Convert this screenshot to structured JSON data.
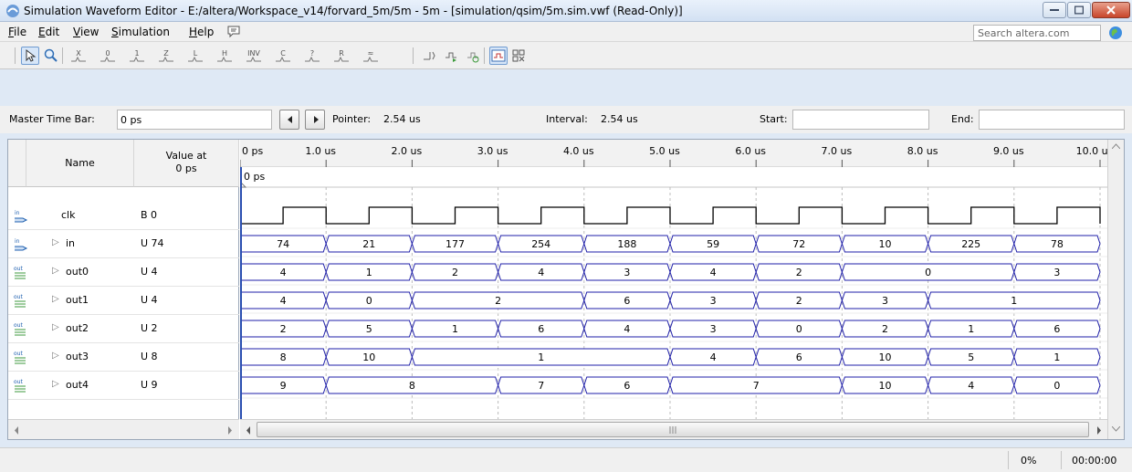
{
  "window": {
    "title": "Simulation Waveform Editor - E:/altera/Workspace_v14/forvard_5m/5m - 5m - [simulation/qsim/5m.sim.vwf (Read-Only)]"
  },
  "menu": {
    "items": [
      {
        "key": "F",
        "rest": "ile"
      },
      {
        "key": "E",
        "rest": "dit"
      },
      {
        "key": "V",
        "rest": "iew"
      },
      {
        "key": "S",
        "rest": "imulation"
      },
      {
        "key": "H",
        "rest": "elp"
      }
    ]
  },
  "search": {
    "placeholder": "Search altera.com"
  },
  "toolbar": {
    "buttons": [
      {
        "icon": "selection-tool-icon"
      },
      {
        "icon": "zoom-tool-icon"
      },
      {
        "icon": "forcing-unknown-icon"
      },
      {
        "icon": "forcing-low-icon"
      },
      {
        "icon": "forcing-high-icon"
      },
      {
        "icon": "high-impedance-icon"
      },
      {
        "icon": "weak-low-icon"
      },
      {
        "icon": "weak-high-icon"
      },
      {
        "icon": "invert-icon"
      },
      {
        "icon": "count-value-icon"
      },
      {
        "icon": "overwrite-clock-icon"
      },
      {
        "icon": "arbitrary-value-icon"
      },
      {
        "icon": "random-value-icon"
      },
      {
        "icon": "snap-to-grid-icon"
      },
      {
        "icon": "grid-settings-icon"
      },
      {
        "icon": "end-time-icon"
      },
      {
        "icon": "run-functional-simulation-icon"
      },
      {
        "icon": "run-timing-simulation-icon"
      }
    ]
  },
  "timebar": {
    "master_label": "Master Time Bar:",
    "master_value": "0 ps",
    "pointer_label": "Pointer:",
    "pointer_value": "2.54 us",
    "interval_label": "Interval:",
    "interval_value": "2.54 us",
    "start_label": "Start:",
    "start_value": "",
    "end_label": "End:",
    "end_value": ""
  },
  "table": {
    "name_header": "Name",
    "value_header_line1": "Value at",
    "value_header_line2": "0 ps",
    "master_marker_label": "0 ps",
    "time_ticks": [
      "0 ps",
      "1.0 us",
      "2.0 us",
      "3.0 us",
      "4.0 us",
      "5.0 us",
      "6.0 us",
      "7.0 us",
      "8.0 us",
      "9.0 us",
      "10.0 us"
    ],
    "signals": [
      {
        "name": "clk",
        "value": "B 0",
        "direction": "in",
        "expandable": false,
        "kind": "clock"
      },
      {
        "name": "in",
        "value": "U 74",
        "direction": "in",
        "expandable": true,
        "kind": "bus",
        "segments": [
          [
            "74",
            0,
            1
          ],
          [
            "21",
            1,
            2
          ],
          [
            "177",
            2,
            3
          ],
          [
            "254",
            3,
            4
          ],
          [
            "188",
            4,
            5
          ],
          [
            "59",
            5,
            6
          ],
          [
            "72",
            6,
            7
          ],
          [
            "10",
            7,
            8
          ],
          [
            "225",
            8,
            9
          ],
          [
            "78",
            9,
            10
          ]
        ]
      },
      {
        "name": "out0",
        "value": "U 4",
        "direction": "out",
        "expandable": true,
        "kind": "bus",
        "segments": [
          [
            "4",
            0,
            1
          ],
          [
            "1",
            1,
            2
          ],
          [
            "2",
            2,
            3
          ],
          [
            "4",
            3,
            4
          ],
          [
            "3",
            4,
            5
          ],
          [
            "4",
            5,
            6
          ],
          [
            "2",
            6,
            7
          ],
          [
            "0",
            7,
            9
          ],
          [
            "3",
            9,
            10
          ]
        ]
      },
      {
        "name": "out1",
        "value": "U 4",
        "direction": "out",
        "expandable": true,
        "kind": "bus",
        "segments": [
          [
            "4",
            0,
            1
          ],
          [
            "0",
            1,
            2
          ],
          [
            "2",
            2,
            4
          ],
          [
            "6",
            4,
            5
          ],
          [
            "3",
            5,
            6
          ],
          [
            "2",
            6,
            7
          ],
          [
            "3",
            7,
            8
          ],
          [
            "1",
            8,
            10
          ]
        ]
      },
      {
        "name": "out2",
        "value": "U 2",
        "direction": "out",
        "expandable": true,
        "kind": "bus",
        "segments": [
          [
            "2",
            0,
            1
          ],
          [
            "5",
            1,
            2
          ],
          [
            "1",
            2,
            3
          ],
          [
            "6",
            3,
            4
          ],
          [
            "4",
            4,
            5
          ],
          [
            "3",
            5,
            6
          ],
          [
            "0",
            6,
            7
          ],
          [
            "2",
            7,
            8
          ],
          [
            "1",
            8,
            9
          ],
          [
            "6",
            9,
            10
          ]
        ]
      },
      {
        "name": "out3",
        "value": "U 8",
        "direction": "out",
        "expandable": true,
        "kind": "bus",
        "segments": [
          [
            "8",
            0,
            1
          ],
          [
            "10",
            1,
            2
          ],
          [
            "1",
            2,
            5
          ],
          [
            "4",
            5,
            6
          ],
          [
            "6",
            6,
            7
          ],
          [
            "10",
            7,
            8
          ],
          [
            "5",
            8,
            9
          ],
          [
            "1",
            9,
            10
          ]
        ]
      },
      {
        "name": "out4",
        "value": "U 9",
        "direction": "out",
        "expandable": true,
        "kind": "bus",
        "segments": [
          [
            "9",
            0,
            1
          ],
          [
            "8",
            1,
            3
          ],
          [
            "7",
            3,
            4
          ],
          [
            "6",
            4,
            5
          ],
          [
            "7",
            5,
            7
          ],
          [
            "10",
            7,
            8
          ],
          [
            "4",
            8,
            9
          ],
          [
            "0",
            9,
            10
          ]
        ]
      }
    ]
  },
  "status": {
    "progress": "0%",
    "elapsed": "00:00:00"
  },
  "colors": {
    "waveform": "#1f1fa8",
    "clock": "#000000",
    "pointer": "#2a4fb0"
  },
  "chart_data": {
    "type": "table",
    "x_unit": "us",
    "xlim": [
      0,
      10
    ],
    "clock_period_us": 1.0,
    "signals": [
      "clk",
      "in",
      "out0",
      "out1",
      "out2",
      "out3",
      "out4"
    ]
  }
}
